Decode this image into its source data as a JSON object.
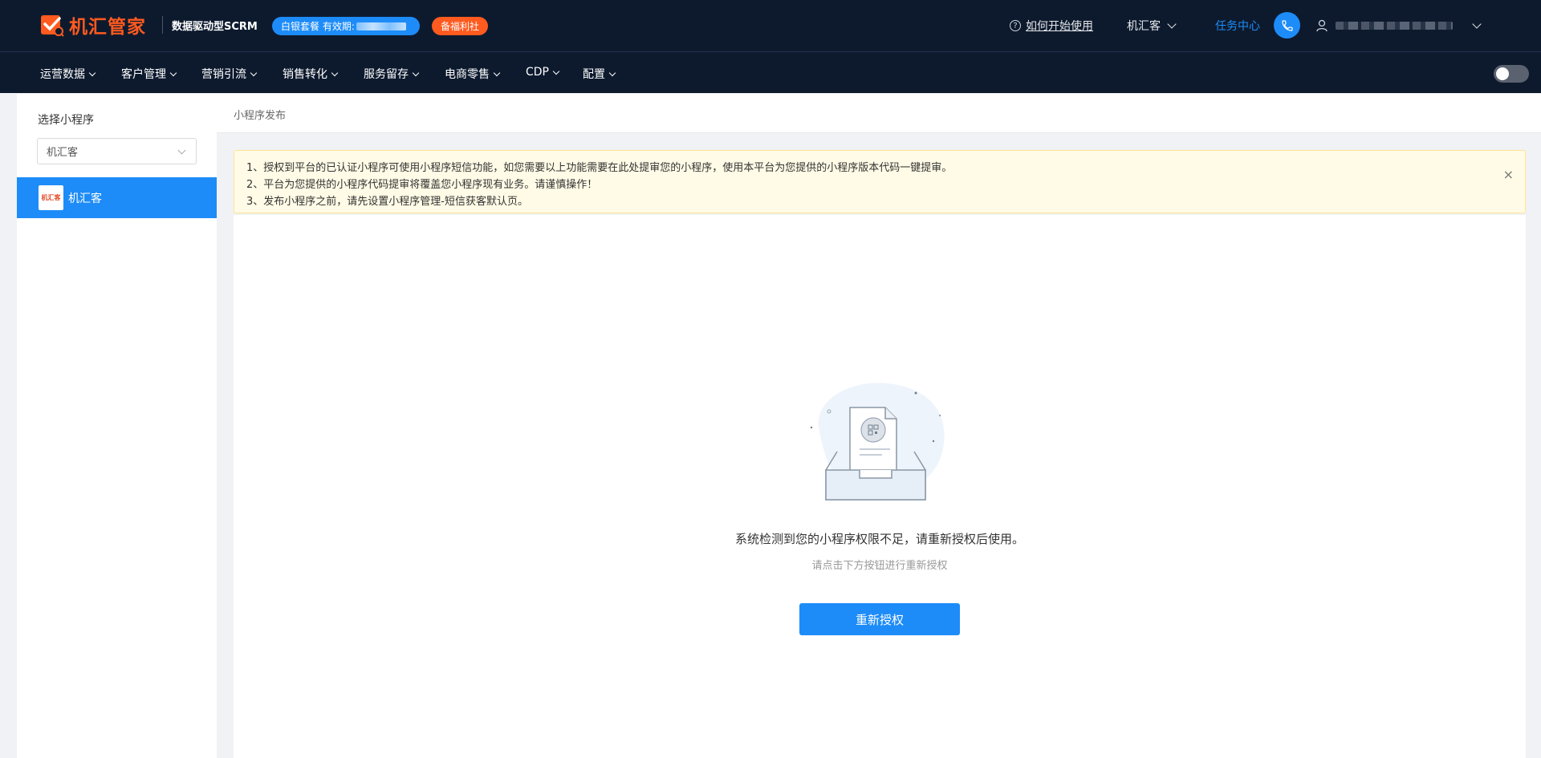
{
  "header": {
    "brand": "机汇管家",
    "tagline": "数据驱动型SCRM",
    "plan_label": "白银套餐 有效期:",
    "welfare_label": "备福利社",
    "help_label": "如何开始使用",
    "account": "机汇客",
    "task_center": "任务中心"
  },
  "nav": {
    "items": [
      "运营数据",
      "客户管理",
      "营销引流",
      "销售转化",
      "服务留存",
      "电商零售",
      "CDP",
      "配置"
    ]
  },
  "sidebar": {
    "title": "选择小程序",
    "select_value": "机汇客",
    "thumb_text": "机汇客",
    "item_name": "机汇客"
  },
  "main": {
    "breadcrumb": "小程序发布",
    "notice": [
      "1、授权到平台的已认证小程序可使用小程序短信功能，如您需要以上功能需要在此处提审您的小程序，使用本平台为您提供的小程序版本代码一键提审。",
      "2、平台为您提供的小程序代码提审将覆盖您小程序现有业务。请谨慎操作！",
      "3、发布小程序之前，请先设置小程序管理-短信获客默认页。"
    ],
    "close_symbol": "×",
    "empty_title": "系统检测到您的小程序权限不足，请重新授权后使用。",
    "empty_sub": "请点击下方按钮进行重新授权",
    "button_label": "重新授权"
  },
  "colors": {
    "header_bg": "#0d1a2e",
    "brand_orange": "#ff5a1f",
    "primary_blue": "#1d8cf8",
    "notice_bg": "#fffbe6"
  }
}
